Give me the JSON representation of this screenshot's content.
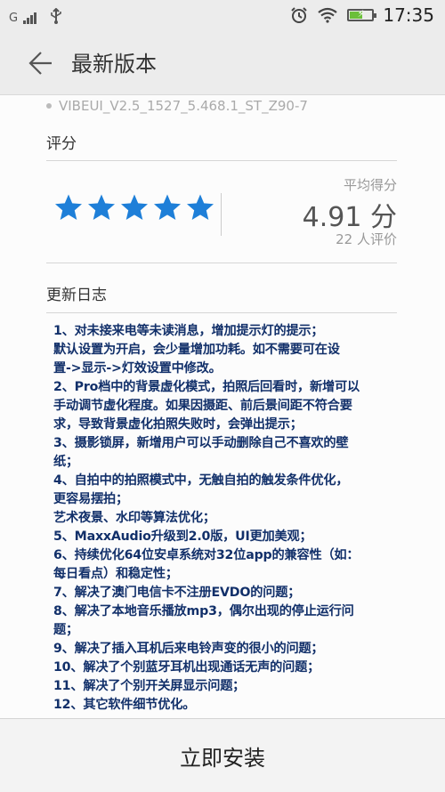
{
  "status_bar": {
    "carrier": "G",
    "time": "17:35",
    "battery_level": 0.55
  },
  "header": {
    "title": "最新版本"
  },
  "version": "VIBEUI_V2.5_1527_5.468.1_ST_Z90-7",
  "rating": {
    "section_title": "评分",
    "stars": 5,
    "average_label": "平均得分",
    "score": "4.91 分",
    "reviews": "22 人评价",
    "star_color": "#1e7fd8"
  },
  "changelog": {
    "section_title": "更新日志",
    "lines": [
      "1、对未接来电等未读消息，增加提示灯的提示；",
      "默认设置为开启，会少量增加功耗。如不需要可在设",
      "置->显示->灯效设置中修改。",
      "2、Pro档中的背景虚化模式，拍照后回看时，新增可以",
      "手动调节虚化程度。如果因摄距、前后景间距不符合要",
      "求，导致背景虚化拍照失败时，会弹出提示；",
      "3、摄影锁屏，新增用户可以手动删除自己不喜欢的壁",
      "纸；",
      "4、自拍中的拍照模式中，无触自拍的触发条件优化，",
      "更容易摆拍；",
      "艺术夜景、水印等算法优化；",
      "5、MaxxAudio升级到2.0版，UI更加美观；",
      "6、持续优化64位安卓系统对32位app的兼容性（如：",
      "每日看点）和稳定性；",
      "7、解决了澳门电信卡不注册EVDO的问题；",
      "8、解决了本地音乐播放mp3，偶尔出现的停止运行问",
      "题；",
      "9、解决了插入耳机后来电铃声变的很小的问题；",
      "10、解决了个别蓝牙耳机出现通话无声的问题；",
      "11、解决了个别开关屏显示问题；",
      "12、其它软件细节优化。"
    ]
  },
  "install_button": {
    "label": "立即安装"
  }
}
